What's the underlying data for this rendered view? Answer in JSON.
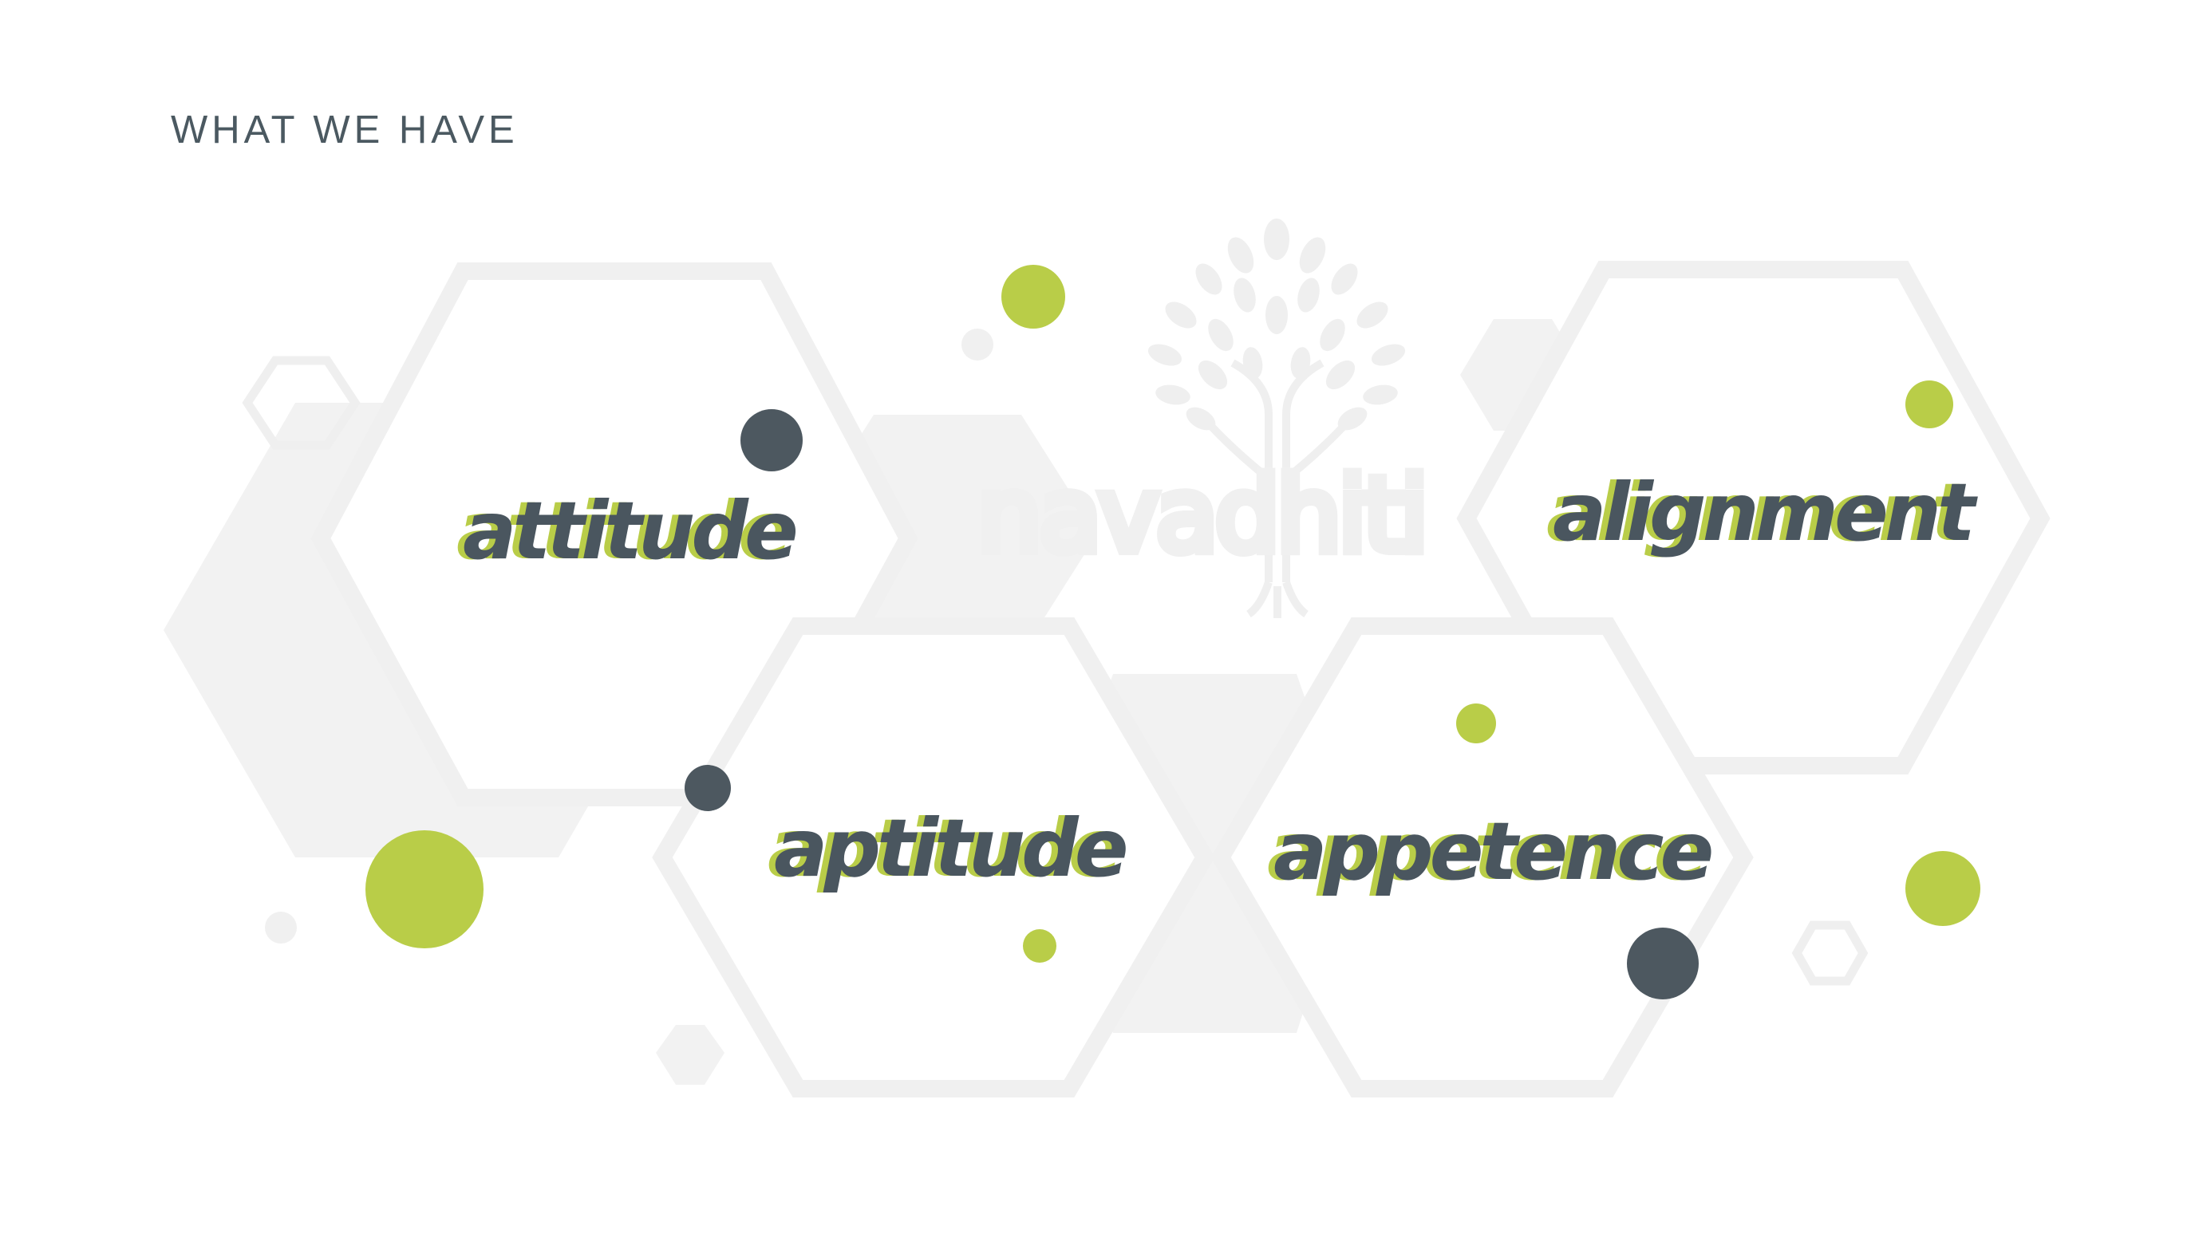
{
  "heading": "WHAT WE HAVE",
  "brand": {
    "name": "navadhiti"
  },
  "nodes": [
    {
      "id": "attitude",
      "label": "attitude"
    },
    {
      "id": "alignment",
      "label": "alignment"
    },
    {
      "id": "aptitude",
      "label": "aptitude"
    },
    {
      "id": "appetence",
      "label": "appetence"
    }
  ],
  "colors": {
    "heading": "#4b5961",
    "text": "#4a565f",
    "accent": "#b9cd48",
    "dot_dark": "#4d5860",
    "hex_fill": "#f2f2f2",
    "hex_stroke": "#f0f0f0",
    "background": "#ffffff"
  }
}
